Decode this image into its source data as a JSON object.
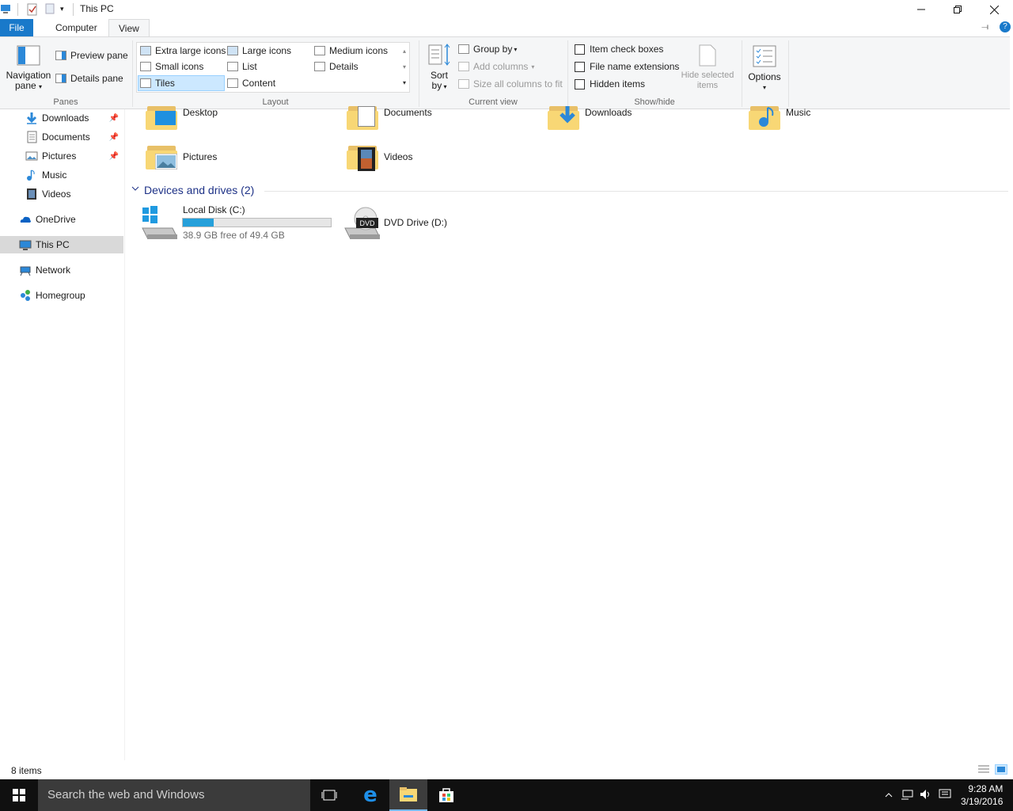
{
  "window": {
    "title": "This PC"
  },
  "tabs": {
    "file": "File",
    "computer": "Computer",
    "view": "View"
  },
  "ribbon": {
    "panes": {
      "navigation_pane_line1": "Navigation",
      "navigation_pane_line2": "pane",
      "preview_pane": "Preview pane",
      "details_pane": "Details pane",
      "group_label": "Panes"
    },
    "layout": {
      "extra_large_icons": "Extra large icons",
      "large_icons": "Large icons",
      "medium_icons": "Medium icons",
      "small_icons": "Small icons",
      "list": "List",
      "details": "Details",
      "tiles": "Tiles",
      "content": "Content",
      "group_label": "Layout"
    },
    "current_view": {
      "sort_line1": "Sort",
      "sort_line2": "by",
      "group_by": "Group by",
      "add_columns": "Add columns",
      "size_all_columns": "Size all columns to fit",
      "group_label": "Current view"
    },
    "show_hide": {
      "item_check_boxes": "Item check boxes",
      "file_name_extensions": "File name extensions",
      "hidden_items": "Hidden items",
      "hide_selected_line1": "Hide selected",
      "hide_selected_line2": "items",
      "group_label": "Show/hide"
    },
    "options": {
      "label": "Options"
    }
  },
  "nav": {
    "items": [
      {
        "label": "Downloads",
        "pinned": true
      },
      {
        "label": "Documents",
        "pinned": true
      },
      {
        "label": "Pictures",
        "pinned": true
      },
      {
        "label": "Music",
        "pinned": false
      },
      {
        "label": "Videos",
        "pinned": false
      },
      {
        "label": "OneDrive"
      },
      {
        "label": "This PC",
        "selected": true
      },
      {
        "label": "Network"
      },
      {
        "label": "Homegroup"
      }
    ]
  },
  "content": {
    "folders": [
      "Desktop",
      "Documents",
      "Downloads",
      "Music",
      "Pictures",
      "Videos"
    ],
    "devices_header": "Devices and drives (2)",
    "drives": [
      {
        "name": "Local Disk (C:)",
        "free_text": "38.9 GB free of 49.4 GB",
        "used_fraction": 0.21
      },
      {
        "name": "DVD Drive (D:)"
      }
    ]
  },
  "status": {
    "item_count": "8 items"
  },
  "taskbar": {
    "search_placeholder": "Search the web and Windows",
    "time": "9:28 AM",
    "date": "3/19/2016"
  },
  "colors": {
    "accent": "#1979ca",
    "drive_bar": "#26a0da",
    "section_header": "#1e3287"
  }
}
